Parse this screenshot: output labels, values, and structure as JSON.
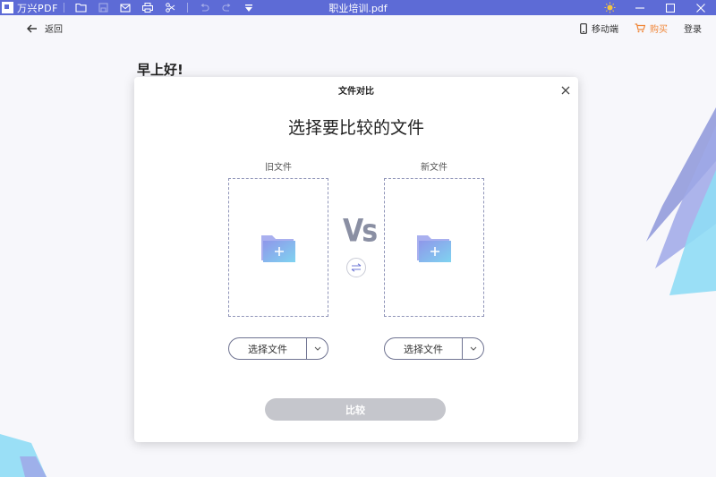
{
  "titlebar": {
    "app_name": "万兴PDF",
    "doc_title": "职业培训.pdf",
    "icons": [
      "open-folder-icon",
      "save-icon",
      "mail-icon",
      "print-icon",
      "cut-icon",
      "undo-icon",
      "redo-icon",
      "dropdown-arrow-icon"
    ],
    "right_icons": [
      "sun-icon",
      "minimize-icon",
      "maximize-icon",
      "close-icon"
    ],
    "accent": "#5d6bd6"
  },
  "header": {
    "back_label": "返回",
    "mobile_label": "移动端",
    "buy_label": "购买",
    "login_label": "登录",
    "buy_color": "#f0873a"
  },
  "greeting": "早上好!",
  "dialog": {
    "title": "文件对比",
    "heading": "选择要比较的文件",
    "old_label": "旧文件",
    "new_label": "新文件",
    "vs_label": "Vs",
    "old_select_label": "选择文件",
    "new_select_label": "选择文件",
    "compare_label": "比较",
    "compare_disabled_color": "#c5c6cc"
  }
}
